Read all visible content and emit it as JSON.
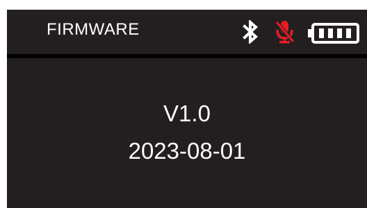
{
  "header": {
    "title": "FIRMWARE",
    "icons": {
      "bluetooth": "bluetooth-icon",
      "mic": "mic-muted-icon",
      "battery": "battery-icon"
    }
  },
  "firmware": {
    "version": "V1.0",
    "date": "2023-08-01"
  },
  "colors": {
    "background": "#231f20",
    "text": "#ffffff",
    "mic_muted": "#e31e24",
    "divider": "#000000"
  },
  "battery": {
    "level_bars": 4,
    "max_bars": 4
  }
}
